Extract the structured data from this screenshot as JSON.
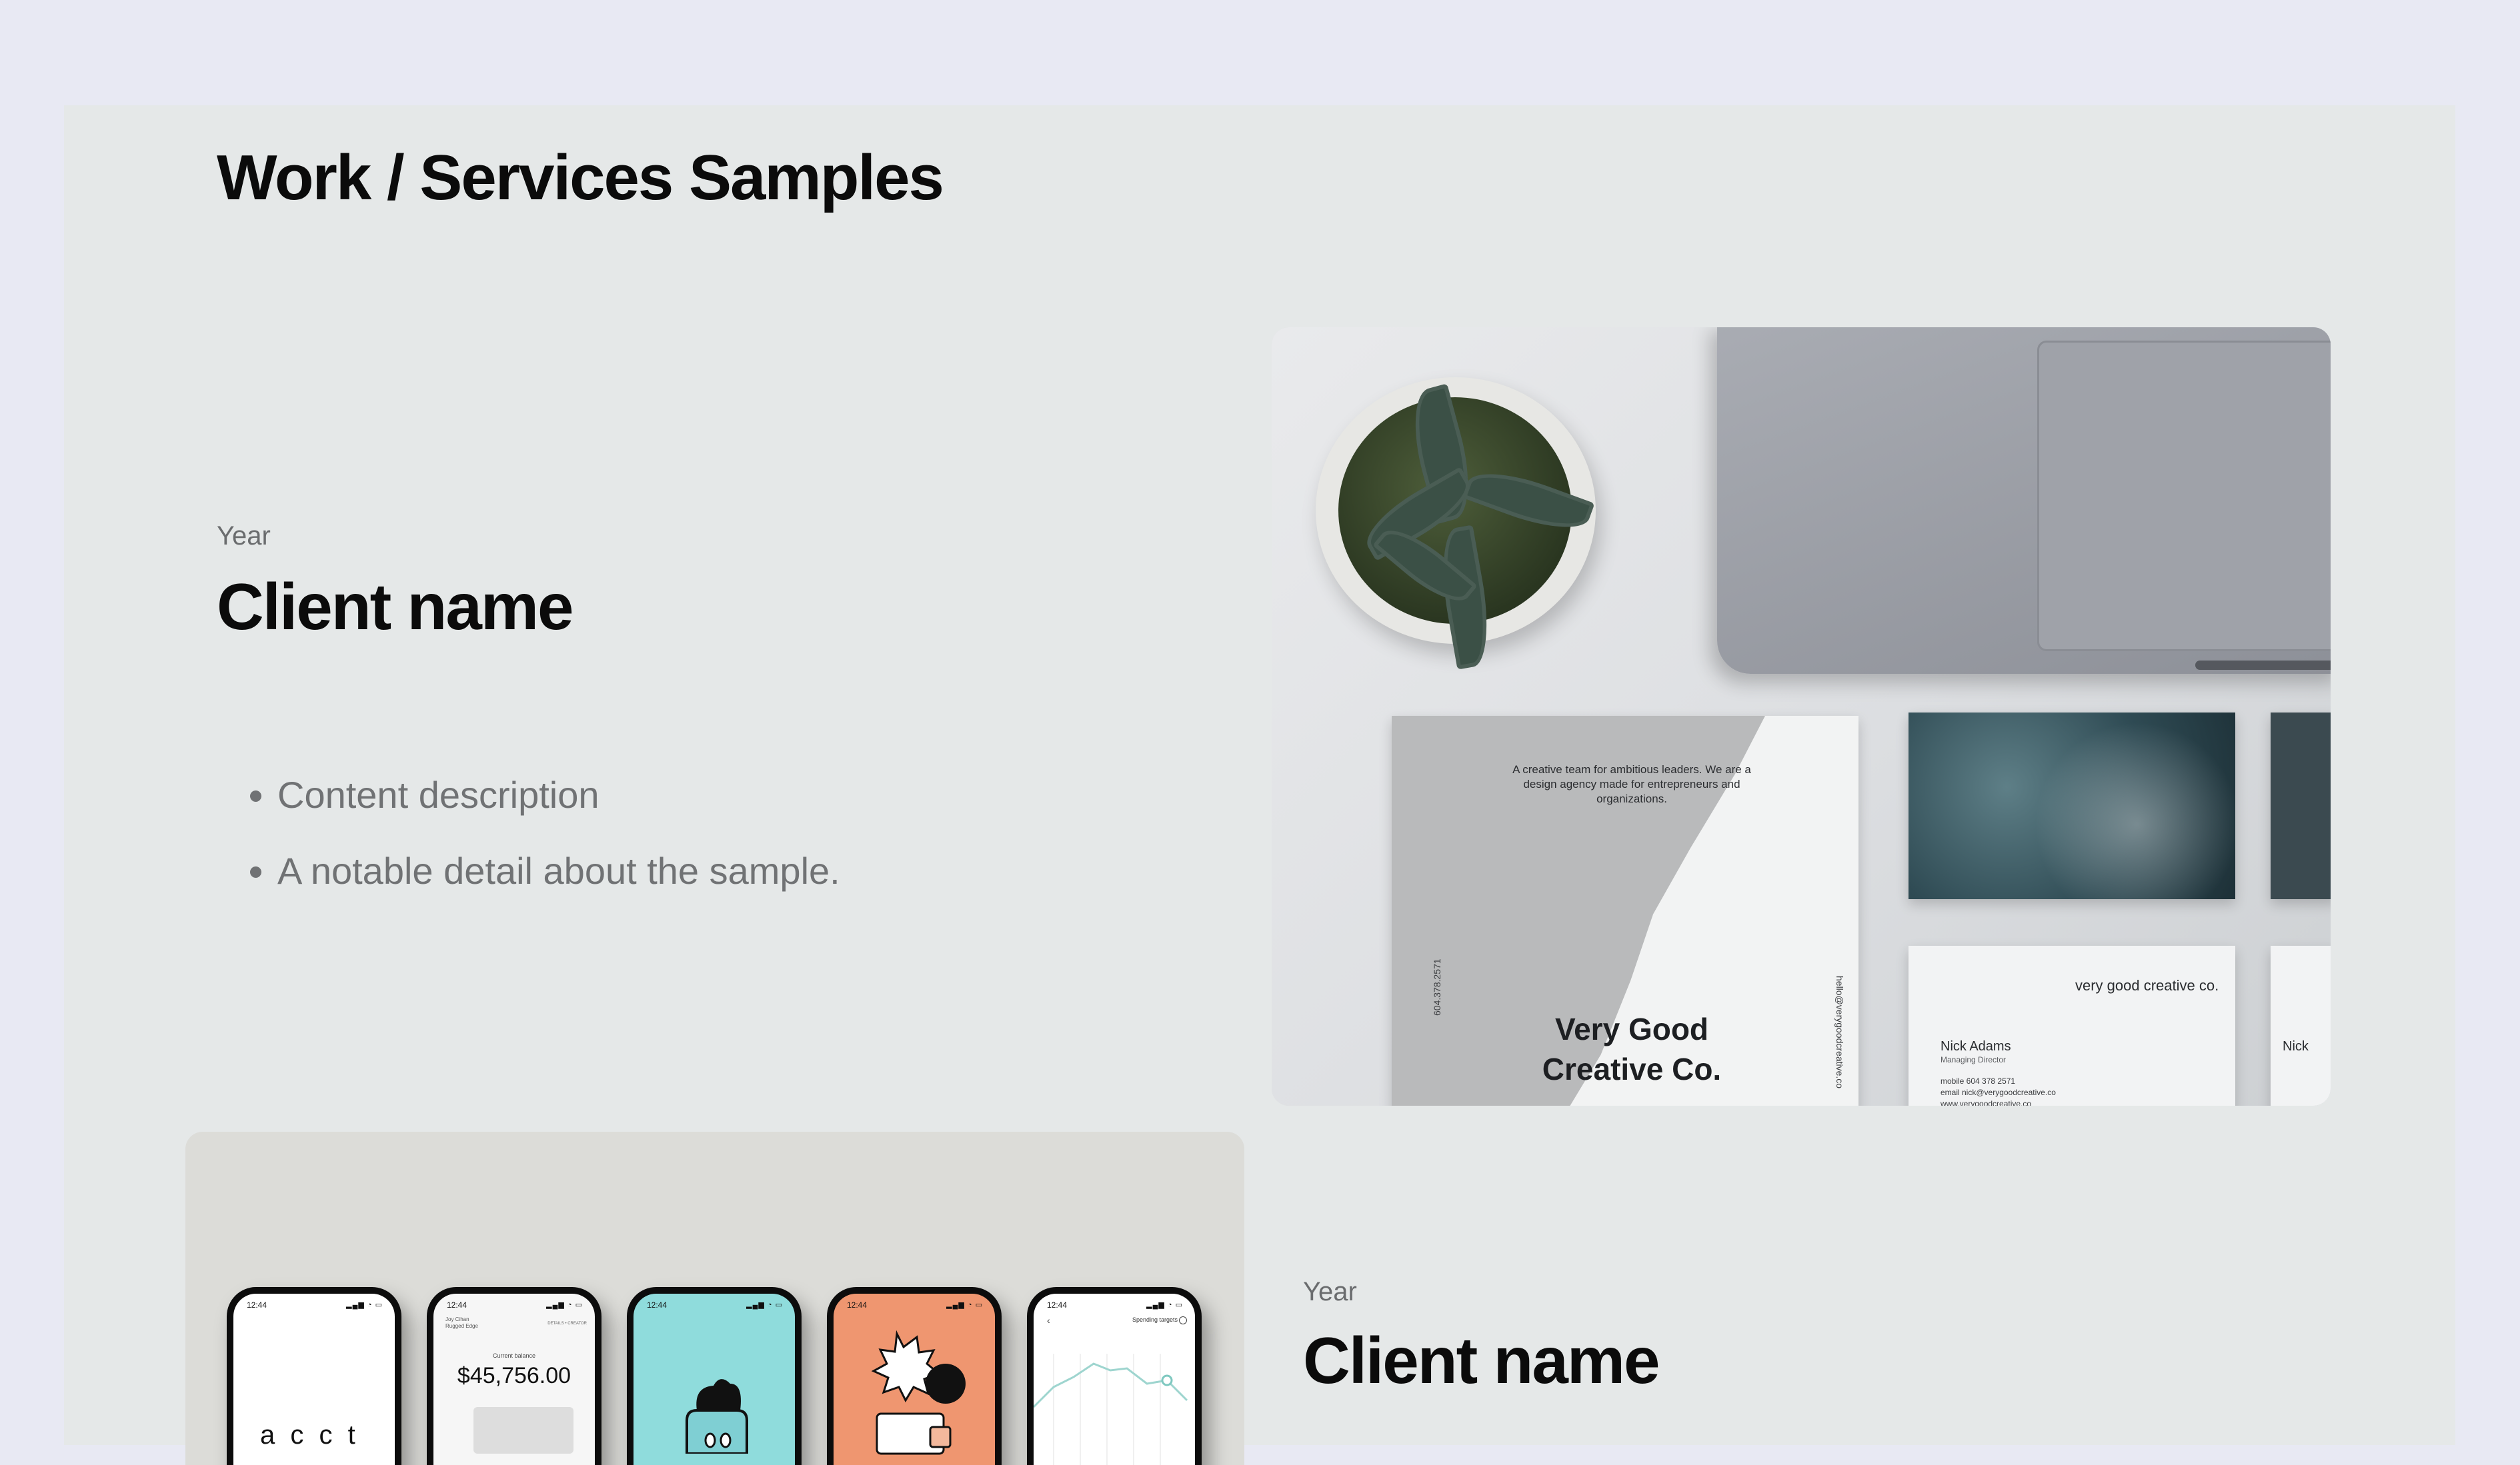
{
  "page": {
    "title": "Work / Services Samples"
  },
  "samples": [
    {
      "year": "Year",
      "client": "Client name",
      "details": [
        "Content description",
        "A notable detail about the sample."
      ],
      "image": {
        "card_tagline": "A creative team for ambitious leaders. We are a design agency made for entrepreneurs and organizations.",
        "card_brand": "Very Good Creative Co.",
        "card_phone": "604.378.2571",
        "card_email": "hello@verygoodcreative.co",
        "contact_brand": "very good creative co.",
        "contact_name": "Nick Adams",
        "contact_role": "Managing Director",
        "contact_mobile": "mobile 604 378 2571",
        "contact_email": "email nick@verygoodcreative.co",
        "contact_web": "www.verygoodcreative.co",
        "edge_name": "Nick"
      }
    },
    {
      "year": "Year",
      "client": "Client name",
      "phones": [
        {
          "time": "12:44",
          "word": "a c c t"
        },
        {
          "time": "12:44",
          "owner": "Joy Cihan\nRugged Edge",
          "action": "DETAILS • CREATOR",
          "label": "Current balance",
          "amount": "$45,756.00"
        },
        {
          "time": "12:44"
        },
        {
          "time": "12:44"
        },
        {
          "time": "12:44",
          "chart_title": "Spending targets"
        }
      ]
    }
  ],
  "colors": {
    "background": "#e8e9f3",
    "panel": "#e5e8e8",
    "heading": "#0b0b0b",
    "muted_text": "#6a6c6e",
    "phone_teal": "#8fdcdc",
    "phone_orange": "#ef9670"
  }
}
